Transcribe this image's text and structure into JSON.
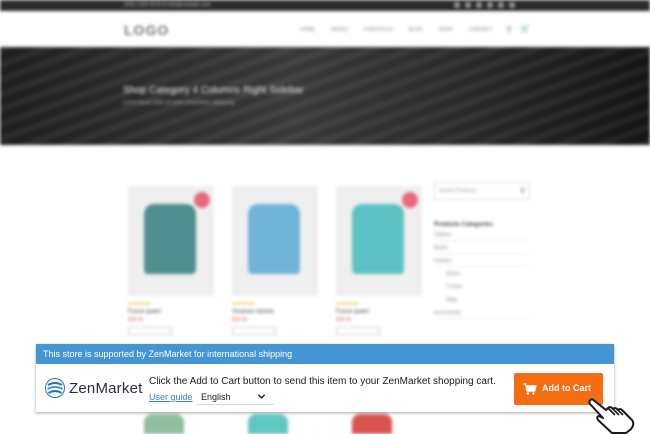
{
  "site": {
    "contact_line": "(555) 1234 5678 ✉ info@example.com",
    "logo": "LOGO",
    "menu": [
      "HOME",
      "PAGES",
      "PORTFOLIO",
      "BLOG",
      "SHOP",
      "CONTACT"
    ],
    "hero_title": "Shop Category 4 Columns Right Sidebar",
    "hero_subtitle": "Lorem ipsum dolor sit amet consectetur adipiscing",
    "products": [
      {
        "name": "Fusce quam",
        "price": "$18.00",
        "shirt_color": "#4f8f8f"
      },
      {
        "name": "Vivamus lacinia",
        "price": "$18.00",
        "shirt_color": "#6fb3d8"
      },
      {
        "name": "Fusce quam",
        "price": "$18.00",
        "shirt_color": "#5cc1c4"
      }
    ],
    "lower_product_colors": [
      "#8fbf9f",
      "#5fc8bf",
      "#d9534f"
    ],
    "sidebar": {
      "search_placeholder": "Search Products …",
      "heading": "Products Categories",
      "categories": [
        "Clothes",
        "Books",
        "Fashion",
        "Shoes",
        "T-shirts",
        "Bags",
        "Accessories"
      ]
    }
  },
  "zenmarket": {
    "header_text": "This store is supported by ZenMarket for international shipping",
    "logo_text": "ZenMarket",
    "message": "Click the Add to Cart button to send this item to your ZenMarket shopping cart.",
    "user_guide_label": "User guide",
    "language": "English",
    "add_to_cart_label": "Add to Cart",
    "colors": {
      "header": "#4594d4",
      "button": "#f46d12",
      "link": "#3f7fc6"
    }
  }
}
